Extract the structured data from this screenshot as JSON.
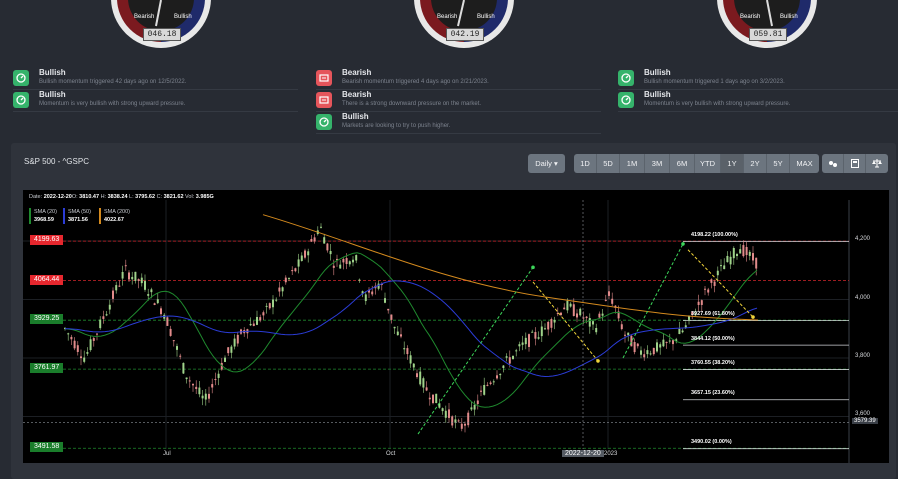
{
  "gauges": [
    {
      "value": "046.18",
      "left": "Bearish",
      "right": "Bullish"
    },
    {
      "value": "042.19",
      "left": "Bearish",
      "right": "Bullish"
    },
    {
      "value": "059.81",
      "left": "Bearish",
      "right": "Bullish"
    }
  ],
  "signals": {
    "col1": [
      {
        "title": "Bullish",
        "desc": "Bullish momentum triggered 42 days ago on 12/5/2022.",
        "type": "bull"
      },
      {
        "title": "Bullish",
        "desc": "Momentum is very bullish with strong upward pressure.",
        "type": "bull"
      }
    ],
    "col2": [
      {
        "title": "Bearish",
        "desc": "Bearish momentum triggered 4 days ago on 2/21/2023.",
        "type": "bear"
      },
      {
        "title": "Bearish",
        "desc": "There is a strong downward pressure on the market.",
        "type": "bear"
      },
      {
        "title": "Bullish",
        "desc": "Markets are looking to try to push higher.",
        "type": "bull"
      }
    ],
    "col3": [
      {
        "title": "Bullish",
        "desc": "Bullish momentum triggered 1 days ago on 3/2/2023.",
        "type": "bull"
      },
      {
        "title": "Bullish",
        "desc": "Momentum is very bullish with strong upward pressure.",
        "type": "bull"
      }
    ]
  },
  "panel": {
    "title": "S&P 500 - ^GSPC",
    "interval": "Daily ▾",
    "ranges": [
      "1D",
      "5D",
      "1M",
      "3M",
      "6M",
      "YTD",
      "1Y",
      "2Y",
      "5Y",
      "MAX"
    ],
    "active_range": "1Y"
  },
  "ohlc": {
    "date_lbl": "Date:",
    "date": "2022-12-20",
    "o_lbl": "O:",
    "o": "3810.47",
    "h_lbl": "H:",
    "h": "3838.24",
    "l_lbl": "L:",
    "l": "3795.62",
    "c_lbl": "C:",
    "c": "3821.62",
    "v_lbl": "Vol:",
    "v": "3.985G"
  },
  "sma": [
    {
      "label": "SMA (20)",
      "value": "3968.59",
      "color": "#1f8a2e"
    },
    {
      "label": "SMA (50)",
      "value": "3871.56",
      "color": "#2b3cd6"
    },
    {
      "label": "SMA (200)",
      "value": "4022.67",
      "color": "#d48a1e"
    }
  ],
  "levels": [
    {
      "label": "4199.63",
      "kind": "red",
      "price": 4199.63
    },
    {
      "label": "4064.44",
      "kind": "red",
      "price": 4064.44
    },
    {
      "label": "3929.25",
      "kind": "grn",
      "price": 3929.25
    },
    {
      "label": "3761.97",
      "kind": "grn",
      "price": 3761.97
    },
    {
      "label": "3491.58",
      "kind": "grn",
      "price": 3491.58
    }
  ],
  "fib": [
    {
      "label": "4198.22 (100.00%)",
      "price": 4198.22
    },
    {
      "label": "3927.69 (61.80%)",
      "price": 3927.69
    },
    {
      "label": "3844.12 (50.00%)",
      "price": 3844.12
    },
    {
      "label": "3760.55 (38.20%)",
      "price": 3760.55
    },
    {
      "label": "3657.15 (23.60%)",
      "price": 3657.15
    },
    {
      "label": "3490.02 (0.00%)",
      "price": 3490.02
    }
  ],
  "y_ticks": [
    "4,200",
    "4,000",
    "3,800",
    "3,600"
  ],
  "x_ticks": [
    "Jul",
    "Oct",
    "2023"
  ],
  "cursor": {
    "date": "2022-12-20",
    "price": "3579.39"
  },
  "colors": {
    "bull": "#35b36b",
    "bear": "#e5555b",
    "candle_up": "#9fd38a",
    "candle_down": "#e28b8b"
  }
}
